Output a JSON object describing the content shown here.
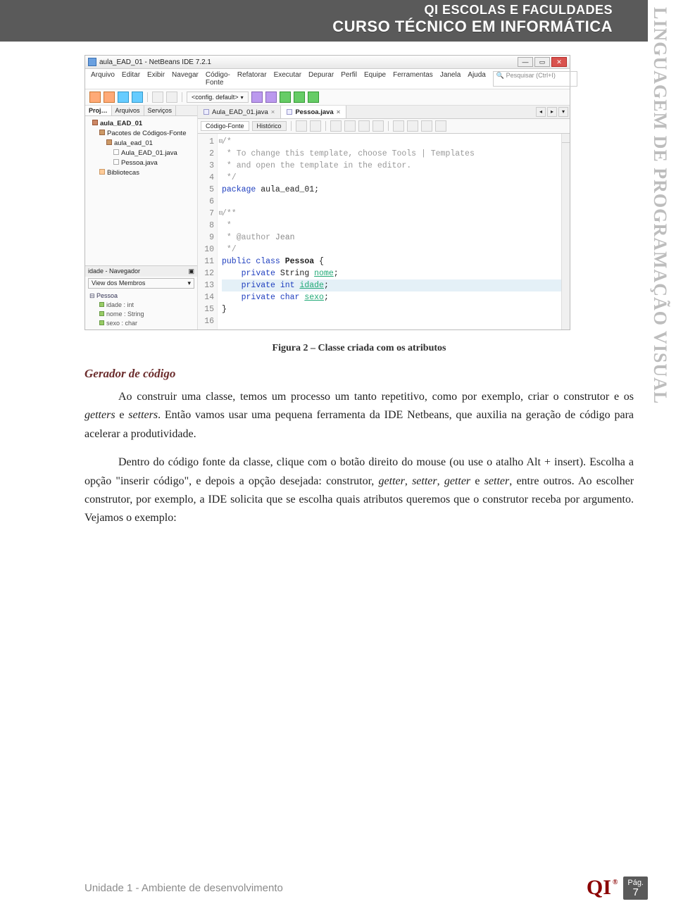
{
  "header": {
    "line1": "QI ESCOLAS E FACULDADES",
    "line2": "CURSO TÉCNICO EM INFORMÁTICA"
  },
  "side_title": "LINGUAGEM DE PROGRAMAÇÃO VISUAL",
  "ide": {
    "title": "aula_EAD_01 - NetBeans IDE 7.2.1",
    "menus": [
      "Arquivo",
      "Editar",
      "Exibir",
      "Navegar",
      "Código-Fonte",
      "Refatorar",
      "Executar",
      "Depurar",
      "Perfil",
      "Equipe",
      "Ferramentas",
      "Janela",
      "Ajuda"
    ],
    "search_placeholder": "Pesquisar (Ctrl+I)",
    "config_label": "<config. default>",
    "left_tabs": [
      "Proj…",
      "Arquivos",
      "Serviços"
    ],
    "project_tree": {
      "root": "aula_EAD_01",
      "group": "Pacotes de Códigos-Fonte",
      "pkg": "aula_ead_01",
      "files": [
        "Aula_EAD_01.java",
        "Pessoa.java"
      ],
      "libs": "Bibliotecas"
    },
    "navigator": {
      "title": "idade - Navegador",
      "combo": "View dos Membros",
      "class": "Pessoa",
      "fields": [
        "idade : int",
        "nome : String",
        "sexo : char"
      ]
    },
    "editor_tabs": [
      {
        "label": "Aula_EAD_01.java",
        "active": false
      },
      {
        "label": "Pessoa.java",
        "active": true
      }
    ],
    "editor_subtabs": [
      "Código-Fonte",
      "Histórico"
    ],
    "code_lines": [
      {
        "n": 1,
        "html": "<span class='c-comm'>/*</span>",
        "fold": true
      },
      {
        "n": 2,
        "html": "<span class='c-comm'> * To change this template, choose Tools | Templates</span>"
      },
      {
        "n": 3,
        "html": "<span class='c-comm'> * and open the template in the editor.</span>"
      },
      {
        "n": 4,
        "html": "<span class='c-comm'> */</span>"
      },
      {
        "n": 5,
        "html": "<span class='c-kw'>package</span> aula_ead_01;"
      },
      {
        "n": 6,
        "html": ""
      },
      {
        "n": 7,
        "html": "<span class='c-comm'>/**</span>",
        "fold": true
      },
      {
        "n": 8,
        "html": "<span class='c-comm'> *</span>"
      },
      {
        "n": 9,
        "html": "<span class='c-comm'> * @author </span><span class='c-str'>Jean</span>"
      },
      {
        "n": 10,
        "html": "<span class='c-comm'> */</span>"
      },
      {
        "n": 11,
        "html": "<span class='c-kw'>public class</span> <b>Pessoa</b> {"
      },
      {
        "n": 12,
        "html": "    <span class='c-kw'>private</span> String <span class='c-field'>nome</span>;"
      },
      {
        "n": 13,
        "html": "    <span class='c-kw'>private</span> <span class='c-type'>int</span> <span class='c-field'>idade</span>;",
        "hl": true
      },
      {
        "n": 14,
        "html": "    <span class='c-kw'>private</span> <span class='c-type'>char</span> <span class='c-field'>sexo</span>;"
      },
      {
        "n": 15,
        "html": "}"
      },
      {
        "n": 16,
        "html": ""
      }
    ]
  },
  "caption": "Figura 2 – Classe criada com os atributos",
  "section_heading": "Gerador de código",
  "paragraphs": [
    "Ao construir uma classe, temos um processo um tanto repetitivo, como por exemplo, criar o construtor e os getters e setters. Então vamos usar uma pequena ferramenta da IDE Netbeans, que auxilia na geração de código para acelerar a produtividade.",
    "Dentro do código fonte da classe, clique com o botão direito do mouse (ou use o atalho Alt + insert). Escolha a opção \"inserir código\", e depois a opção desejada: construtor, getter, setter, getter e setter, entre outros. Ao escolher construtor, por exemplo, a IDE solicita que se escolha quais atributos queremos que o construtor receba por argumento. Vejamos o exemplo:"
  ],
  "footer": {
    "text": "Unidade 1 - Ambiente de desenvolvimento",
    "page_label": "Pág.",
    "page_number": "7",
    "logo": "QI"
  }
}
